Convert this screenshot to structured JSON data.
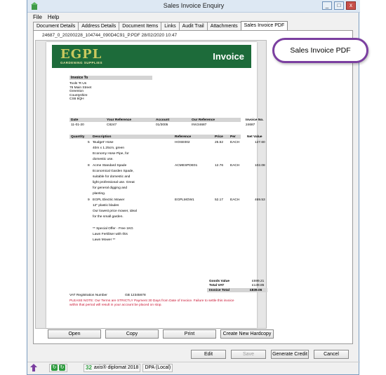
{
  "window": {
    "title": "Sales Invoice Enquiry",
    "minimize": "_",
    "maximize": "□",
    "close": "x"
  },
  "menu": [
    "File",
    "Help"
  ],
  "tabs": [
    "Document Details",
    "Address Details",
    "Document Items",
    "Links",
    "Audit Trail",
    "Attachments",
    "Sales Invoice PDF"
  ],
  "file_line": "24687_0_20200228_104744_090D4C91_P.PDF 28/02/2020 10:47",
  "invoice": {
    "logo_big": "EGPL",
    "logo_small": "GARDENING SUPPLIES",
    "title": "Invoice",
    "invoice_to_label": "Invoice To",
    "address": [
      "Tools 'R Us",
      "76 Main Street",
      "Greenton",
      "Countyshire",
      "CS6 8QH"
    ],
    "ref_headers": {
      "date": "Date",
      "your_ref": "Your Reference",
      "account": "Account",
      "our_ref": "Our Reference",
      "inv_no": "Invoice No."
    },
    "ref_values": {
      "date": "11-01-20",
      "your_ref": "C8247",
      "account": "01/3005",
      "our_ref": "INV24687",
      "inv_no": "24687"
    },
    "item_headers": {
      "qty": "Quantity",
      "desc": "Description",
      "ref": "Reference",
      "price": "Price",
      "per": "Per",
      "net": "Net Value"
    },
    "items": [
      {
        "qty": "5",
        "desc": [
          "'Budget' Hose",
          "40m x 1.25cm, green",
          "Economy Hose Pipe, for",
          "domestic use."
        ],
        "ref": "HOSE002",
        "price": "25.52",
        "per": "EACH",
        "net": "127.60"
      },
      {
        "qty": "8",
        "desc": [
          "Acme Standard Spade",
          "Economical Garden Spade,",
          "suitable for domestic and",
          "light professional use. Great",
          "for general digging and",
          "planting."
        ],
        "ref": "ACMESPDE01",
        "price": "12.76",
        "per": "EACH",
        "net": "102.08"
      },
      {
        "qty": "9",
        "desc": [
          "EGPL Electric Mower",
          "12\" plastic blades",
          "Our lowest price mower, ideal",
          "for the small garden.",
          "",
          "** Special Offer - Free 1KG",
          "Lawn Fertiliser with this",
          "Lawn Mower **"
        ],
        "ref": "EGPLMOW1",
        "price": "52.17",
        "per": "EACH",
        "net": "469.53"
      }
    ],
    "totals": [
      {
        "label": "Goods Value",
        "value": "£699.21"
      },
      {
        "label": "Total VAT",
        "value": "£139.85"
      },
      {
        "label": "Invoice Total",
        "value": "£839.06"
      }
    ],
    "vat_label": "VAT Registration Number",
    "vat_number": "GB 12345678",
    "warning": [
      "PLEASE NOTE: Our Terms are STRICTLY Payment 30 Days from Date of Invoice. Failure to settle this invoice",
      "within that period will result in your account be placed on stop."
    ]
  },
  "pdf_buttons": [
    "Open",
    "Copy",
    "Print",
    "Create New Hardcopy"
  ],
  "action_buttons": [
    "Edit",
    "Save",
    "Generate Credit",
    "Cancel"
  ],
  "status": {
    "count": "32",
    "app": "axis® diplomat 2018",
    "db": "DPA (Local)"
  },
  "callout": "Sales Invoice PDF",
  "colors": {
    "invoice_header": "#1d6b3a",
    "logo": "#c9c95e",
    "callout_border": "#7b3fa0",
    "warning": "#c8102e"
  }
}
